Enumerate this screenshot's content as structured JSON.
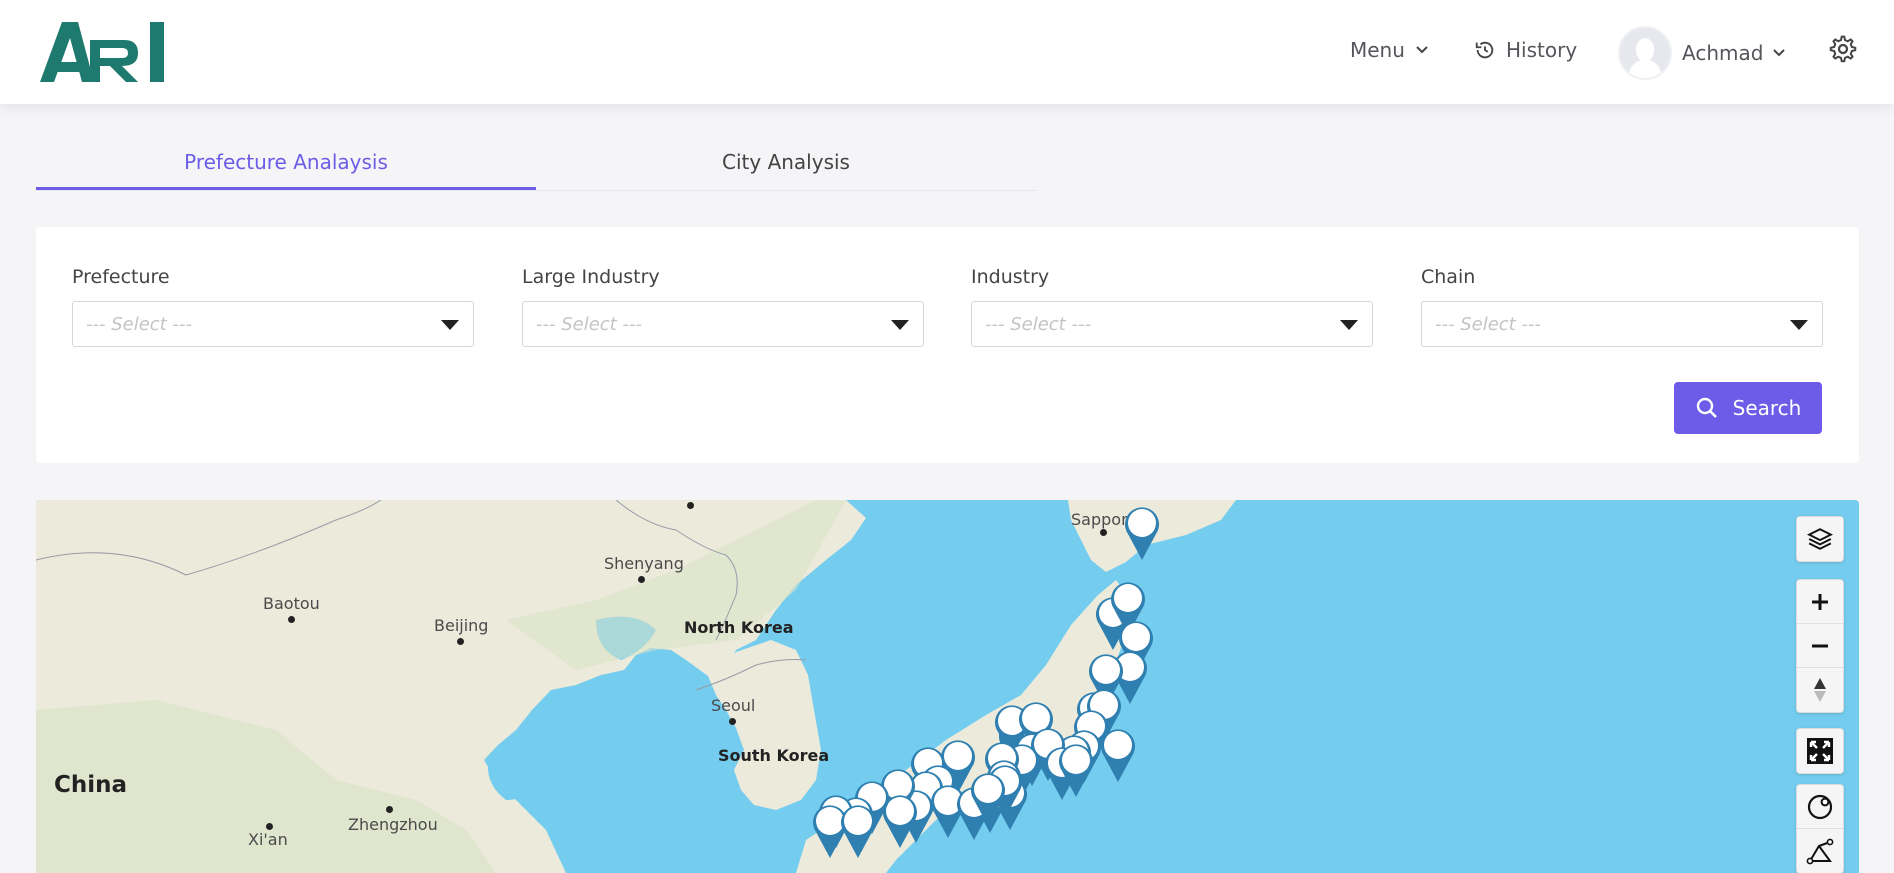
{
  "header": {
    "logo_text": "ARI",
    "menu_label": "Menu",
    "history_label": "History",
    "user_name": "Achmad"
  },
  "tabs": [
    {
      "label": "Prefecture Analaysis",
      "active": true
    },
    {
      "label": "City Analysis",
      "active": false
    }
  ],
  "filters": {
    "prefecture": {
      "label": "Prefecture",
      "placeholder": "--- Select ---"
    },
    "large_industry": {
      "label": "Large Industry",
      "placeholder": "--- Select ---"
    },
    "industry": {
      "label": "Industry",
      "placeholder": "--- Select ---"
    },
    "chain": {
      "label": "Chain",
      "placeholder": "--- Select ---"
    },
    "search_label": "Search"
  },
  "map": {
    "labels": {
      "sapporo": "Sappor",
      "shenyang": "Shenyang",
      "baotou": "Baotou",
      "beijing": "Beijing",
      "north_korea": "North Korea",
      "seoul": "Seoul",
      "south_korea": "South Korea",
      "china": "China",
      "xian": "Xi'an",
      "zhengzhou": "Zhengzhou"
    },
    "controls": [
      "layers-icon",
      "zoom-in-icon",
      "zoom-out-icon",
      "compass-icon",
      "fullscreen-icon",
      "rotate-icon",
      "measure-icon"
    ]
  },
  "colors": {
    "accent": "#6c5ce7",
    "logo": "#1e7a6e",
    "sea": "#74cdef",
    "land": "#eceadb",
    "pin": "#2f7fb0"
  }
}
